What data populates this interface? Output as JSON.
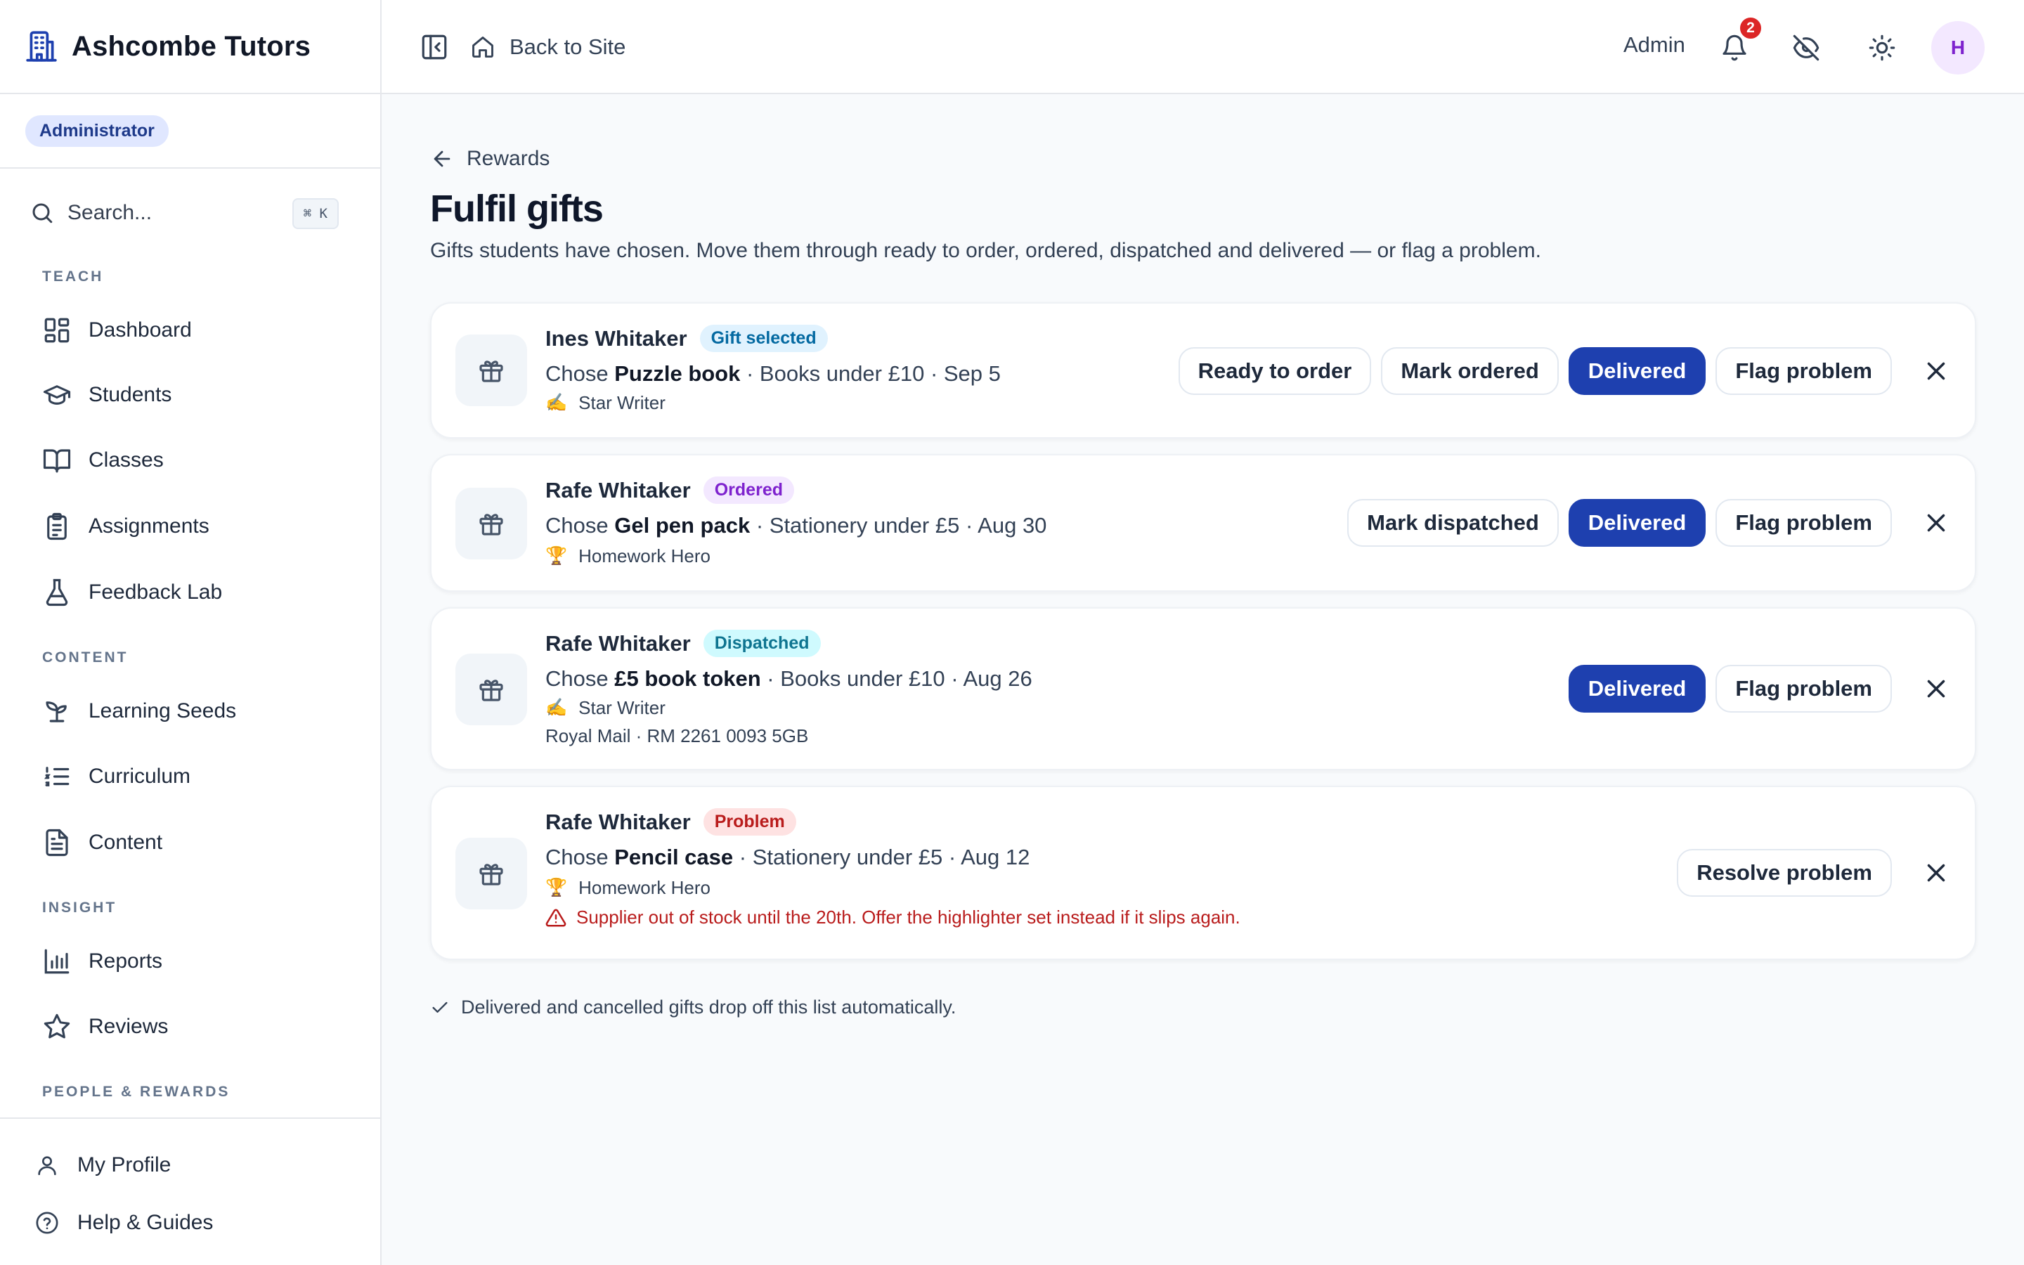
{
  "app": {
    "name": "Ashcombe Tutors",
    "role": "Administrator"
  },
  "sidebar": {
    "search_label": "Search...",
    "search_shortcut": "⌘ K",
    "sections": {
      "teach": "TEACH",
      "content": "CONTENT",
      "insight": "INSIGHT",
      "people": "PEOPLE & REWARDS"
    },
    "items": {
      "dashboard": "Dashboard",
      "students": "Students",
      "classes": "Classes",
      "assignments": "Assignments",
      "feedback_lab": "Feedback Lab",
      "learning_seeds": "Learning Seeds",
      "curriculum": "Curriculum",
      "content": "Content",
      "reports": "Reports",
      "reviews": "Reviews"
    },
    "footer": {
      "profile": "My Profile",
      "help": "Help & Guides"
    }
  },
  "topbar": {
    "back_to_site": "Back to Site",
    "admin_label": "Admin",
    "notification_count": "2",
    "avatar_initial": "H"
  },
  "page": {
    "back_label": "Rewards",
    "title": "Fulfil gifts",
    "subtitle": "Gifts students have chosen. Move them through ready to order, ordered, dispatched and delivered — or flag a problem.",
    "footnote": "Delivered and cancelled gifts drop off this list automatically."
  },
  "gifts": [
    {
      "student": "Ines Whitaker",
      "status": "Gift selected",
      "chose": "Chose",
      "item": "Puzzle book",
      "meta": "· Books under £10 · Sep 5",
      "badge_emoji": "✍️",
      "badge": "Star Writer",
      "actions": [
        "Ready to order",
        "Mark ordered",
        "Delivered",
        "Flag problem"
      ]
    },
    {
      "student": "Rafe Whitaker",
      "status": "Ordered",
      "chose": "Chose",
      "item": "Gel pen pack",
      "meta": "· Stationery under £5 · Aug 30",
      "badge_emoji": "🏆",
      "badge": "Homework Hero",
      "actions": [
        "Mark dispatched",
        "Delivered",
        "Flag problem"
      ]
    },
    {
      "student": "Rafe Whitaker",
      "status": "Dispatched",
      "chose": "Chose",
      "item": "£5 book token",
      "meta": "· Books under £10 · Aug 26",
      "badge_emoji": "✍️",
      "badge": "Star Writer",
      "tracking": "Royal Mail · RM 2261 0093 5GB",
      "actions": [
        "Delivered",
        "Flag problem"
      ]
    },
    {
      "student": "Rafe Whitaker",
      "status": "Problem",
      "chose": "Chose",
      "item": "Pencil case",
      "meta": "· Stationery under £5 · Aug 12",
      "badge_emoji": "🏆",
      "badge": "Homework Hero",
      "problem_note": "Supplier out of stock until the 20th. Offer the highlighter set instead if it slips again.",
      "actions": [
        "Resolve problem"
      ]
    }
  ],
  "colors": {
    "primary": "#1e40af",
    "problem": "#b91c1c",
    "notification": "#dc2626"
  }
}
